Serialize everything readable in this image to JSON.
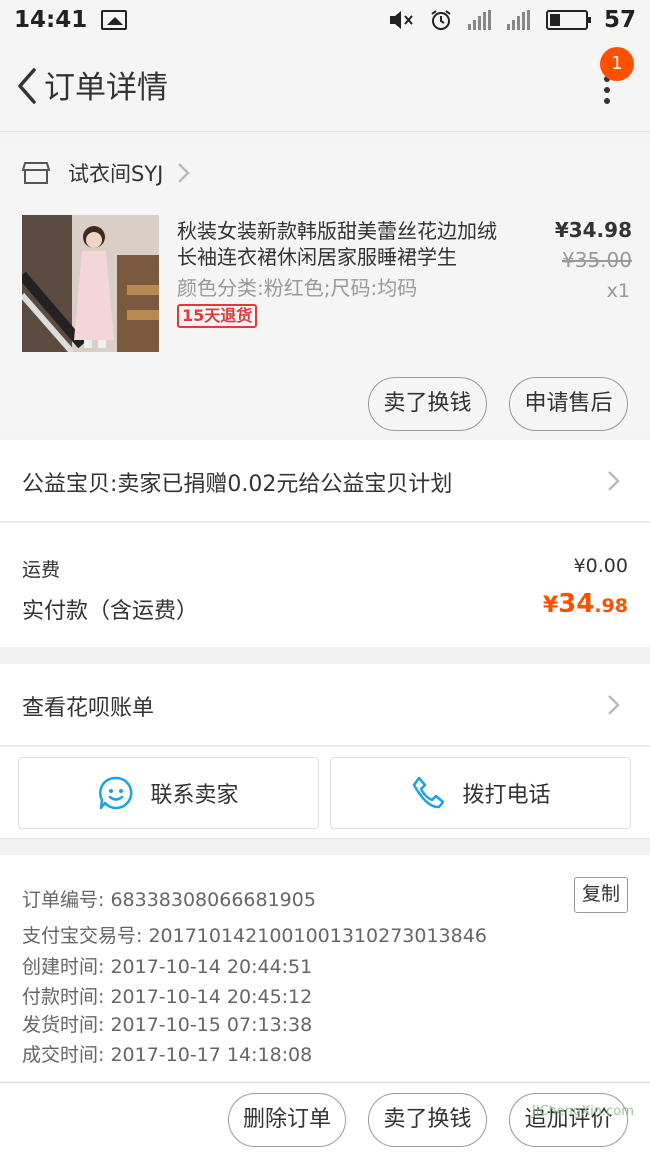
{
  "status_bar": {
    "time": "14:41",
    "battery": "57"
  },
  "nav": {
    "title": "订单详情",
    "badge_count": "1"
  },
  "shop": {
    "name": "试衣间SYJ"
  },
  "product": {
    "title": "秋装女装新款韩版甜美蕾丝花边加绒长袖连衣裙休闲居家服睡裙学生",
    "sku": "颜色分类:粉红色;尺码:均码",
    "tag": "15天退货",
    "price": "¥34.98",
    "original_price": "¥35.00",
    "quantity": "x1",
    "buttons": {
      "sell_label": "卖了换钱",
      "after_sale_label": "申请售后"
    }
  },
  "charity": {
    "text": "公益宝贝:卖家已捐赠0.02元给公益宝贝计划"
  },
  "freight": {
    "label": "运费",
    "value": "¥0.00",
    "total_label": "实付款（含运费）",
    "total_symbol": "¥",
    "total_integer": "34",
    "total_decimal": ".98"
  },
  "huabei": {
    "label": "查看花呗账单"
  },
  "contact": {
    "seller_label": "联系卖家",
    "phone_label": "拨打电话"
  },
  "order_info": {
    "copy_label": "复制",
    "lines": [
      "订单编号: 68338308066681905",
      "支付宝交易号: 2017101421001001310273013846",
      "创建时间: 2017-10-14 20:44:51",
      "付款时间: 2017-10-14 20:45:12",
      "发货时间: 2017-10-15 07:13:38",
      "成交时间: 2017-10-17 14:18:08"
    ]
  },
  "bottom": {
    "delete_label": "删除订单",
    "sell_label": "卖了换钱",
    "review_label": "追加评价"
  },
  "watermark": "JiChengXin.com",
  "colors": {
    "accent": "#ff5000",
    "tag_red": "#e4393c",
    "icon_blue": "#1aa3e8"
  }
}
